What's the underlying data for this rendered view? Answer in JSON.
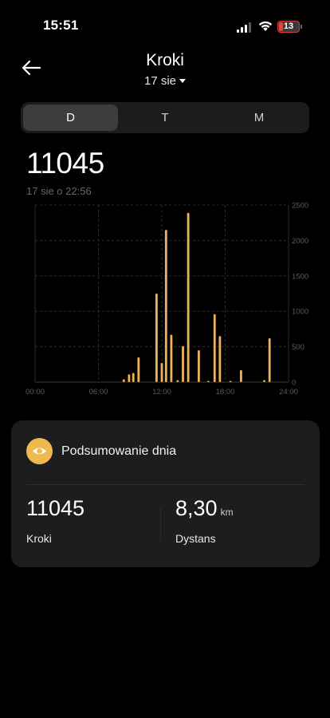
{
  "status_bar": {
    "time": "15:51",
    "battery": "13",
    "signal_icon": "signal-bars-icon",
    "wifi_icon": "wifi-icon"
  },
  "header": {
    "title": "Kroki",
    "date": "17 sie",
    "back_icon": "arrow-left-icon",
    "dropdown_icon": "caret-down-icon"
  },
  "tabs": [
    {
      "label": "D",
      "active": true
    },
    {
      "label": "T",
      "active": false
    },
    {
      "label": "M",
      "active": false
    }
  ],
  "summary_value": "11045",
  "timestamp": "17 sie o 22:56",
  "colors": {
    "accent": "#efb94f",
    "bar": "#f0b15e",
    "background": "#000000",
    "card": "#1d1d1f"
  },
  "chart_data": {
    "type": "bar",
    "x_ticks": [
      "00:00",
      "06:00",
      "12:00",
      "18:00",
      "24:00"
    ],
    "y_ticks": [
      "0",
      "500",
      "1000",
      "1500",
      "2000",
      "2500"
    ],
    "ylim": [
      0,
      2500
    ],
    "xlim": [
      0,
      24
    ],
    "grid": true,
    "bars": [
      {
        "hour": 8.4,
        "value": 40
      },
      {
        "hour": 8.9,
        "value": 110
      },
      {
        "hour": 9.3,
        "value": 130
      },
      {
        "hour": 9.8,
        "value": 350
      },
      {
        "hour": 11.5,
        "value": 1250
      },
      {
        "hour": 12.0,
        "value": 270
      },
      {
        "hour": 12.4,
        "value": 2150
      },
      {
        "hour": 12.9,
        "value": 670
      },
      {
        "hour": 13.5,
        "value": 30
      },
      {
        "hour": 14.0,
        "value": 510
      },
      {
        "hour": 14.5,
        "value": 2390
      },
      {
        "hour": 15.5,
        "value": 450
      },
      {
        "hour": 16.4,
        "value": 10
      },
      {
        "hour": 17.0,
        "value": 960
      },
      {
        "hour": 17.5,
        "value": 650
      },
      {
        "hour": 18.5,
        "value": 15
      },
      {
        "hour": 19.5,
        "value": 170
      },
      {
        "hour": 21.7,
        "value": 30
      },
      {
        "hour": 22.2,
        "value": 620
      }
    ]
  },
  "day_summary": {
    "title": "Podsumowanie dnia",
    "icon": "eye-icon",
    "steps": {
      "value": "11045",
      "label": "Kroki"
    },
    "distance": {
      "value": "8,30",
      "unit": "km",
      "label": "Dystans"
    }
  }
}
